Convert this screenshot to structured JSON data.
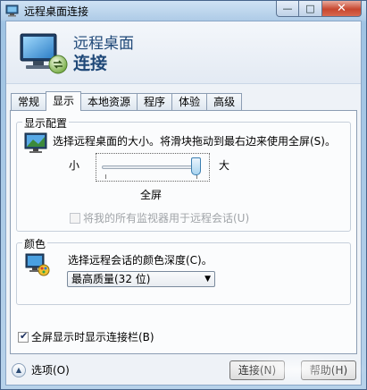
{
  "window": {
    "title": "远程桌面连接",
    "controls": {
      "minimize": "—",
      "maximize": "□",
      "close": "✕"
    }
  },
  "banner": {
    "line1": "远程桌面",
    "line2": "连接"
  },
  "tabs": [
    {
      "label": "常规",
      "active": false
    },
    {
      "label": "显示",
      "active": true
    },
    {
      "label": "本地资源",
      "active": false
    },
    {
      "label": "程序",
      "active": false
    },
    {
      "label": "体验",
      "active": false
    },
    {
      "label": "高级",
      "active": false
    }
  ],
  "display_config": {
    "title": "显示配置",
    "description": "选择远程桌面的大小。将滑块拖动到最右边来使用全屏(S)。",
    "small_label": "小",
    "large_label": "大",
    "slider_value_fraction": 1.0,
    "resolution_label": "全屏",
    "multimon_label": "将我的所有监视器用于远程会话(U)",
    "multimon_checked": false
  },
  "colors": {
    "title": "颜色",
    "description": "选择远程会话的颜色深度(C)。",
    "selected": "最高质量(32 位)"
  },
  "fullscreen_bar": {
    "label": "全屏显示时显示连接栏(B)",
    "checked": true
  },
  "footer": {
    "options_label": "选项(O)",
    "connect_label": "连接(N)",
    "help_label": "帮助(H)"
  },
  "accent_colors": {
    "banner_text": "#1f4878",
    "titlebar": "#aecbe7"
  }
}
